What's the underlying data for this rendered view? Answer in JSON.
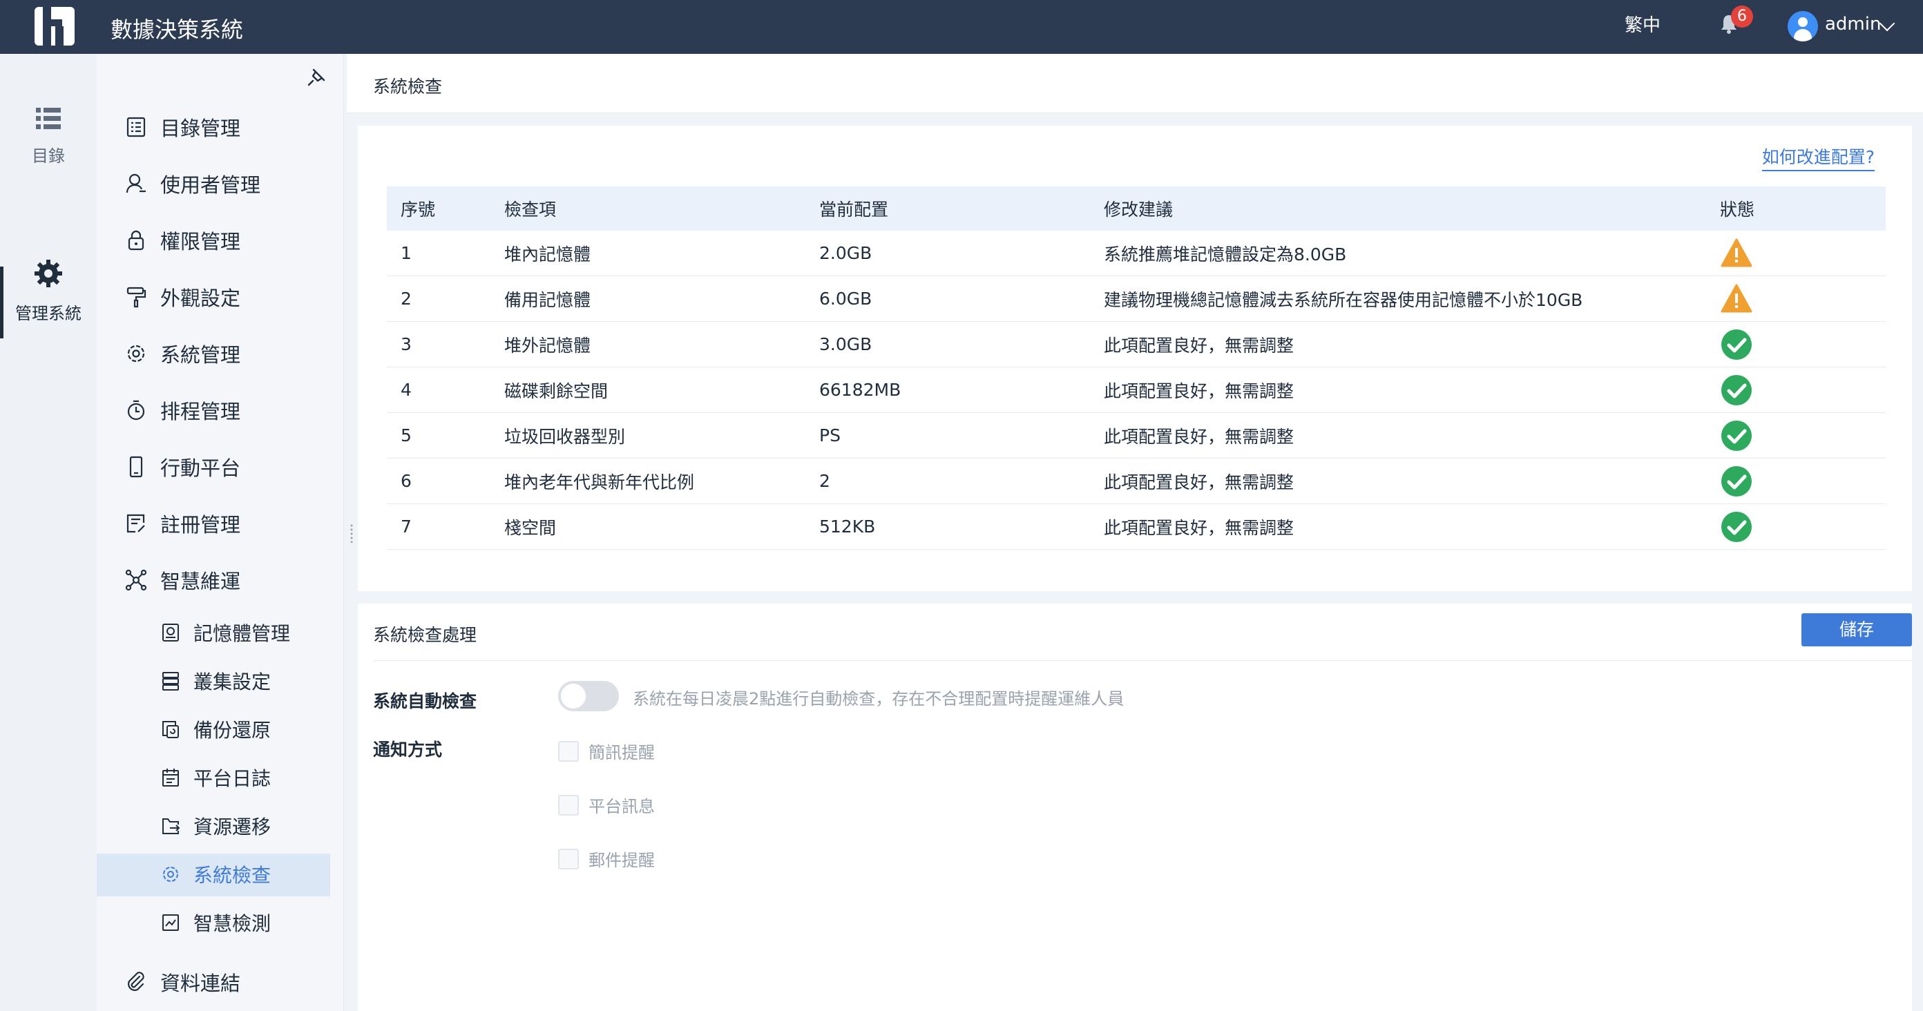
{
  "header": {
    "title": "數據決策系統",
    "language": "繁中",
    "notification_count": "6",
    "username": "admin"
  },
  "rail": {
    "items": [
      {
        "label": "目錄",
        "icon": "list-icon"
      },
      {
        "label": "管理系統",
        "icon": "gear-icon"
      }
    ]
  },
  "menu": {
    "items": [
      {
        "label": "目錄管理",
        "icon": "catalog-icon"
      },
      {
        "label": "使用者管理",
        "icon": "user-icon"
      },
      {
        "label": "權限管理",
        "icon": "lock-icon"
      },
      {
        "label": "外觀設定",
        "icon": "paint-roller-icon"
      },
      {
        "label": "系統管理",
        "icon": "settings-icon"
      },
      {
        "label": "排程管理",
        "icon": "timer-icon"
      },
      {
        "label": "行動平台",
        "icon": "mobile-icon"
      },
      {
        "label": "註冊管理",
        "icon": "register-icon"
      },
      {
        "label": "智慧維運",
        "icon": "network-icon"
      }
    ],
    "sub_items": [
      {
        "label": "記憶體管理",
        "icon": "memory-icon"
      },
      {
        "label": "叢集設定",
        "icon": "server-icon"
      },
      {
        "label": "備份還原",
        "icon": "backup-icon"
      },
      {
        "label": "平台日誌",
        "icon": "calendar-icon"
      },
      {
        "label": "資源遷移",
        "icon": "folder-export-icon"
      },
      {
        "label": "系統檢查",
        "icon": "settings-icon"
      },
      {
        "label": "智慧檢測",
        "icon": "monitor-chart-icon"
      }
    ],
    "bottom_item": {
      "label": "資料連結",
      "icon": "paperclip-icon"
    }
  },
  "page": {
    "title": "系統檢查",
    "improve_link": "如何改進配置?"
  },
  "table": {
    "headers": [
      "序號",
      "檢查項",
      "當前配置",
      "修改建議",
      "狀態"
    ],
    "rows": [
      {
        "no": "1",
        "item": "堆內記憶體",
        "current": "2.0GB",
        "suggestion": "系統推薦堆記憶體設定為8.0GB",
        "status": "warning"
      },
      {
        "no": "2",
        "item": "備用記憶體",
        "current": "6.0GB",
        "suggestion": "建議物理機總記憶體減去系統所在容器使用記憶體不小於10GB",
        "status": "warning"
      },
      {
        "no": "3",
        "item": "堆外記憶體",
        "current": "3.0GB",
        "suggestion": "此項配置良好，無需調整",
        "status": "ok"
      },
      {
        "no": "4",
        "item": "磁碟剩餘空間",
        "current": "66182MB",
        "suggestion": "此項配置良好，無需調整",
        "status": "ok"
      },
      {
        "no": "5",
        "item": "垃圾回收器型別",
        "current": "PS",
        "suggestion": "此項配置良好，無需調整",
        "status": "ok"
      },
      {
        "no": "6",
        "item": "堆內老年代與新年代比例",
        "current": "2",
        "suggestion": "此項配置良好，無需調整",
        "status": "ok"
      },
      {
        "no": "7",
        "item": "棧空間",
        "current": "512KB",
        "suggestion": "此項配置良好，無需調整",
        "status": "ok"
      }
    ]
  },
  "processing": {
    "title": "系統檢查處理",
    "save_label": "儲存",
    "auto_check_label": "系統自動檢查",
    "auto_check_enabled": false,
    "auto_check_desc": "系統在每日凌晨2點進行自動檢查，存在不合理配置時提醒運維人員",
    "notify_label": "通知方式",
    "notify_options": [
      {
        "label": "簡訊提醒",
        "checked": false
      },
      {
        "label": "平台訊息",
        "checked": false
      },
      {
        "label": "郵件提醒",
        "checked": false
      }
    ]
  },
  "colors": {
    "topbar": "#2c3a52",
    "accent": "#3e7bd9",
    "warning": "#f0a030",
    "ok": "#2eaa5e"
  }
}
